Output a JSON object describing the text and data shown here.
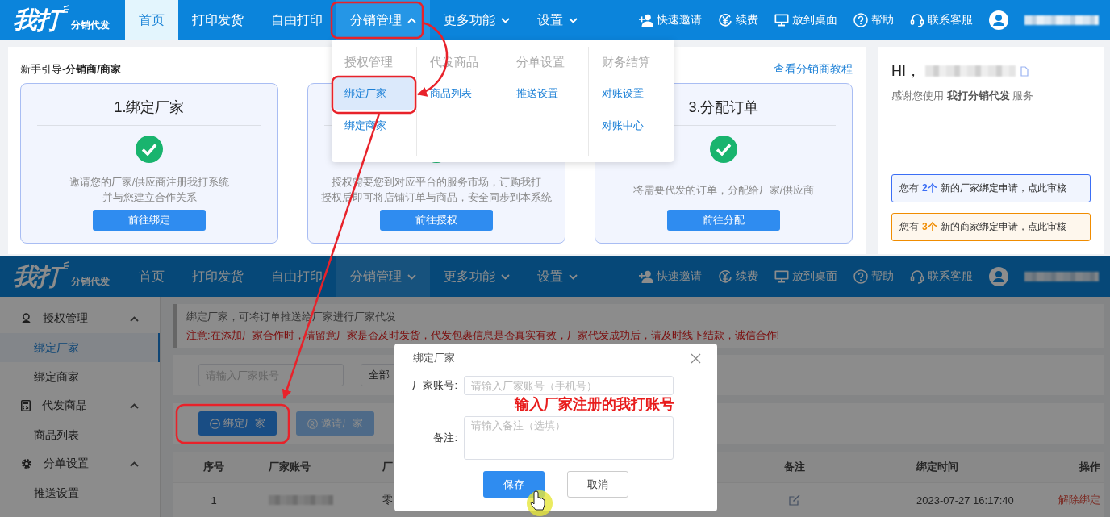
{
  "top_screen": {
    "navbar": {
      "logo": {
        "text": "我打",
        "subtitle": "分销代发"
      },
      "items": [
        {
          "label": "首页",
          "selected": true,
          "has_menu": false,
          "expanded": false
        },
        {
          "label": "打印发货",
          "selected": false,
          "has_menu": false,
          "expanded": false
        },
        {
          "label": "自由打印",
          "selected": false,
          "has_menu": false,
          "expanded": false
        },
        {
          "label": "分销管理",
          "selected": false,
          "has_menu": true,
          "expanded": true
        },
        {
          "label": "更多功能",
          "selected": false,
          "has_menu": true,
          "expanded": false
        },
        {
          "label": "设置",
          "selected": false,
          "has_menu": true,
          "expanded": false
        }
      ],
      "actions": [
        {
          "label": "快速邀请",
          "kind": "invite"
        },
        {
          "label": "续费",
          "kind": "renew"
        },
        {
          "label": "放到桌面",
          "kind": "desktop"
        },
        {
          "label": "帮助",
          "kind": "help"
        },
        {
          "label": "联系客服",
          "kind": "service"
        }
      ]
    },
    "dropdown": {
      "columns": [
        {
          "heading": "授权管理",
          "items": [
            {
              "label": "绑定厂家",
              "selected": true
            },
            {
              "label": "绑定商家",
              "selected": false
            }
          ]
        },
        {
          "heading": "代发商品",
          "items": [
            {
              "label": "商品列表",
              "selected": false
            }
          ]
        },
        {
          "heading": "分单设置",
          "items": [
            {
              "label": "推送设置",
              "selected": false
            }
          ]
        },
        {
          "heading": "财务结算",
          "items": [
            {
              "label": "对账设置",
              "selected": false
            },
            {
              "label": "对账中心",
              "selected": false
            }
          ]
        }
      ]
    },
    "guide": {
      "title": "新手引导-**分销商/商家**",
      "link": "查看分销商教程",
      "steps": [
        {
          "title": "1.绑定厂家",
          "lines": [
            "邀请您的厂家/供应商注册我打系统",
            "并与您建立合作关系"
          ],
          "button": "前往绑定"
        },
        {
          "lines": [
            "授权需要您到对应平台的服务市场，订购我打",
            "授权后即可将店铺订单与商品，安全同步到本系统"
          ],
          "button": "前往授权"
        },
        {
          "title": "3.分配订单",
          "lines": [
            "将需要代发的订单，分配给厂家/供应商"
          ],
          "button": "前往分配"
        }
      ]
    },
    "welcome": {
      "greeting": "HI，",
      "thanks": "感谢您使用 **我打分销代发** 服务",
      "notices": [
        {
          "before": "您有",
          "count": "2个",
          "after": "新的厂家绑定申请，点此审核",
          "color": "#3b6ef5"
        },
        {
          "before": "您有",
          "count": "3个",
          "after": "新的商家绑定申请，点此审核",
          "color": "#f08c00"
        }
      ]
    }
  },
  "bottom_screen": {
    "navbar": {
      "logo": {
        "text": "我打",
        "subtitle": "分销代发"
      },
      "items": [
        {
          "label": "首页",
          "selected": false,
          "has_menu": false,
          "expanded": false
        },
        {
          "label": "打印发货",
          "selected": false,
          "has_menu": false,
          "expanded": false
        },
        {
          "label": "自由打印",
          "selected": false,
          "has_menu": false,
          "expanded": false
        },
        {
          "label": "分销管理",
          "selected": true,
          "has_menu": true,
          "expanded": false
        },
        {
          "label": "更多功能",
          "selected": false,
          "has_menu": true,
          "expanded": false
        },
        {
          "label": "设置",
          "selected": false,
          "has_menu": true,
          "expanded": false
        }
      ],
      "actions": [
        {
          "label": "快速邀请",
          "kind": "invite"
        },
        {
          "label": "续费",
          "kind": "renew"
        },
        {
          "label": "放到桌面",
          "kind": "desktop"
        },
        {
          "label": "帮助",
          "kind": "help"
        },
        {
          "label": "联系客服",
          "kind": "service"
        }
      ]
    },
    "sidebar": [
      {
        "label": "授权管理",
        "kind": "auth",
        "expanded": true,
        "children": [
          {
            "label": "绑定厂家",
            "selected": true
          },
          {
            "label": "绑定商家",
            "selected": false
          }
        ]
      },
      {
        "label": "代发商品",
        "kind": "goods",
        "expanded": true,
        "children": [
          {
            "label": "商品列表",
            "selected": false
          }
        ]
      },
      {
        "label": "分单设置",
        "kind": "settings",
        "expanded": true,
        "children": [
          {
            "label": "推送设置",
            "selected": false
          }
        ]
      }
    ],
    "info": {
      "text": "绑定厂家，可将订单推送给厂家进行厂家代发",
      "warning": "注意:在添加厂家合作时，请留意厂家是否及时发货，代发包裹信息是否真实有效，厂家代发成功后，请及时线下结款，诚信合作!"
    },
    "filters": {
      "account_placeholder": "请输入厂家账号",
      "status": "全部"
    },
    "toolbar": [
      {
        "label": "绑定厂家",
        "kind": "primary"
      },
      {
        "label": "邀请厂家",
        "kind": "invite"
      }
    ],
    "table": {
      "columns": [
        "序号",
        "厂家账号",
        "厂",
        "备注",
        "绑定时间",
        "操作"
      ],
      "rows": [
        {
          "index": "1",
          "column_3": "零",
          "time": "2023-07-27 16:17:40",
          "action": "解除绑定"
        }
      ]
    },
    "dialog": {
      "title": "绑定厂家",
      "fields": [
        {
          "label": "厂家账号:",
          "placeholder": "请输入厂家账号（手机号）",
          "kind": "input"
        },
        {
          "label": "备注:",
          "placeholder": "请输入备注（选填）",
          "kind": "textarea"
        }
      ],
      "buttons": [
        {
          "label": "保存",
          "kind": "primary"
        },
        {
          "label": "取消",
          "kind": "default"
        }
      ]
    },
    "annotation": "输入厂家注册的我打账号"
  }
}
